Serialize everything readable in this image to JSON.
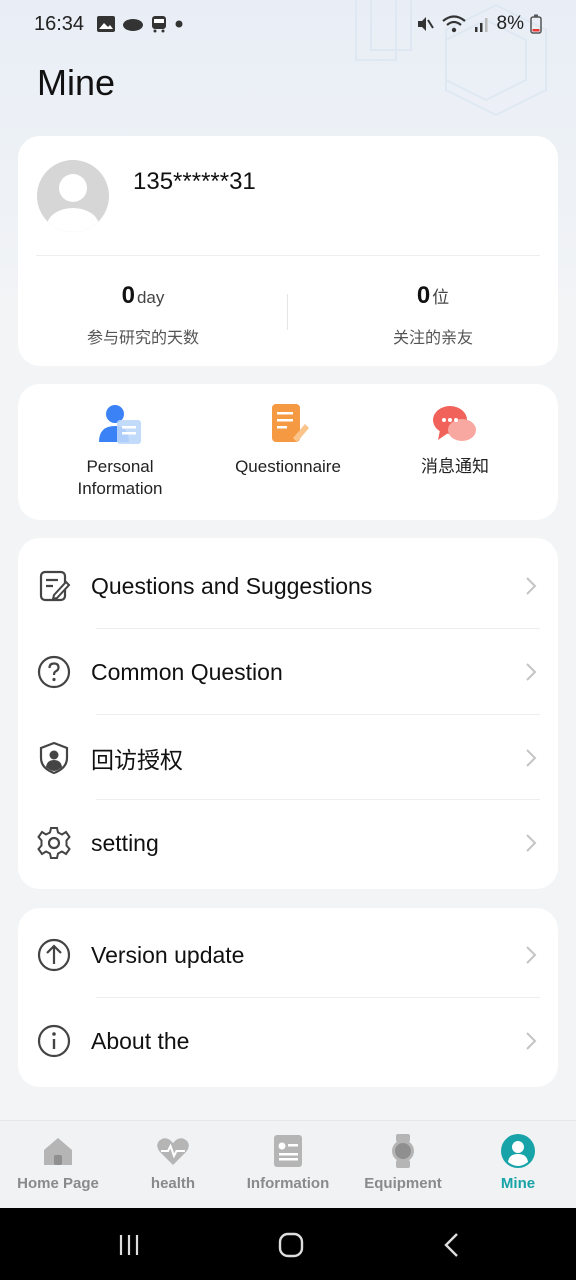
{
  "status_bar": {
    "time": "16:34",
    "battery_text": "8%"
  },
  "page": {
    "title": "Mine"
  },
  "profile": {
    "phone": "135******31",
    "stats": [
      {
        "value": "0",
        "unit": "day",
        "label": "参与研究的天数"
      },
      {
        "value": "0",
        "unit": "位",
        "label": "关注的亲友"
      }
    ]
  },
  "quick_actions": [
    {
      "label_line1": "Personal",
      "label_line2": "Information",
      "icon": "personal-info-icon"
    },
    {
      "label_line1": "Questionnaire",
      "label_line2": "",
      "icon": "questionnaire-icon"
    },
    {
      "label_line1": "消息通知",
      "label_line2": "",
      "icon": "message-notification-icon"
    }
  ],
  "menu_group_1": [
    {
      "label": "Questions and Suggestions",
      "icon": "feedback-edit-icon"
    },
    {
      "label": "Common Question",
      "icon": "question-circle-icon"
    },
    {
      "label": "回访授权",
      "icon": "shield-user-icon"
    },
    {
      "label": "setting",
      "icon": "gear-icon"
    }
  ],
  "menu_group_2": [
    {
      "label": "Version update",
      "icon": "arrow-up-circle-icon"
    },
    {
      "label": "About the",
      "icon": "info-circle-icon"
    }
  ],
  "bottom_nav": [
    {
      "label": "Home Page",
      "icon": "home-icon",
      "active": false
    },
    {
      "label": "health",
      "icon": "heart-pulse-icon",
      "active": false
    },
    {
      "label": "Information",
      "icon": "news-icon",
      "active": false
    },
    {
      "label": "Equipment",
      "icon": "watch-icon",
      "active": false
    },
    {
      "label": "Mine",
      "icon": "user-icon",
      "active": true
    }
  ],
  "colors": {
    "accent": "#17a3a8",
    "inactive_nav": "#8a8a8a",
    "card_bg": "#ffffff",
    "page_bg": "#f3f4f6"
  }
}
